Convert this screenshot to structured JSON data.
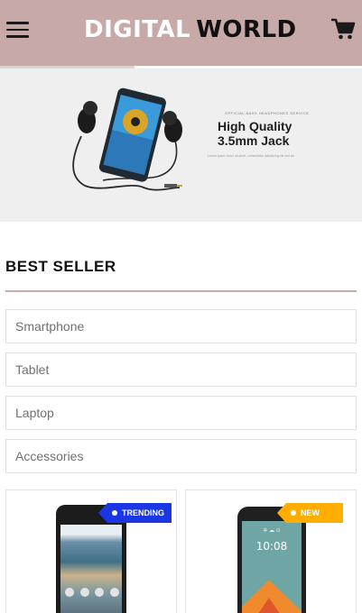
{
  "header": {
    "brand_first": "DIGITAL",
    "brand_second": "WORLD",
    "background_color": "#c7aaa8",
    "menu_icon": "hamburger-menu-icon",
    "cart_icon": "shopping-cart-icon"
  },
  "banner": {
    "small_text": "OFFICIAL BASS HEADPHONES SERVICE",
    "title": "High Quality 3.5mm Jack",
    "subtitle": "Lorem ipsum dolor sit amet, consectetur adipiscing elit sed do"
  },
  "best_seller": {
    "heading": "BEST SELLER",
    "accent_color": "#c9aca9",
    "categories": [
      "Smartphone",
      "Tablet",
      "Laptop",
      "Accessories"
    ]
  },
  "products": [
    {
      "badge": "TRENDING",
      "badge_color": "#1b36e3"
    },
    {
      "badge": "NEW",
      "badge_color": "#ffae00",
      "screen_time": "10:08"
    }
  ]
}
